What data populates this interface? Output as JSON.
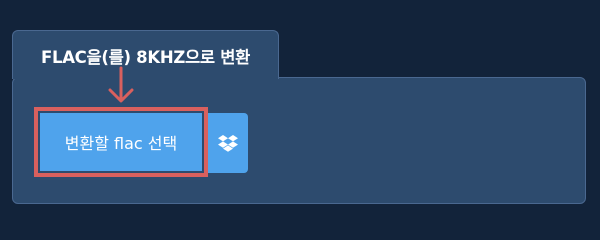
{
  "tab": {
    "title": "FLAC을(를) 8KHZ으로 변환"
  },
  "actions": {
    "select_label": "변환할 flac 선택",
    "dropbox_icon": "dropbox-icon"
  },
  "colors": {
    "background": "#12233a",
    "panel": "#2d4b6e",
    "panel_border": "#4a6890",
    "button": "#4fa3ec",
    "highlight": "#d9605e"
  }
}
